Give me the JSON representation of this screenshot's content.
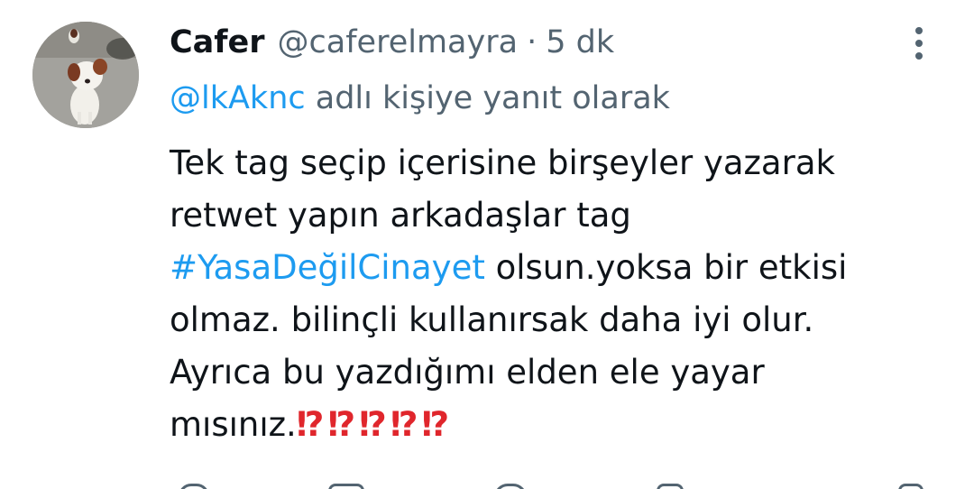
{
  "tweet": {
    "display_name": "Cafer",
    "handle": "@caferelmayra",
    "separator": "·",
    "time": "5 dk",
    "reply_mention": "@lkAknc",
    "reply_suffix": " adlı kişiye yanıt olarak",
    "body": {
      "line1": "Tek tag seçip içerisine birşeyler yazarak",
      "line2": "retwet yapın arkadaşlar tag",
      "hashtag": "#YasaDeğilCinayet",
      "line3_rest": " olsun.yoksa bir etkisi",
      "line4": "olmaz. bilinçli kullanırsak daha iyi olur.",
      "line5": "Ayrıca bu yazdığımı elden ele yayar",
      "line6": "mısınız.",
      "bangs": [
        "⁉",
        "⁉",
        "⁉",
        "⁉",
        "⁉"
      ]
    }
  },
  "icons": {
    "avatar": "dog-photo-avatar",
    "more": "more-vertical-icon",
    "actions": [
      "reply-icon",
      "retweet-icon",
      "like-icon",
      "views-icon",
      "share-icon"
    ]
  },
  "colors": {
    "link": "#1d9bf0",
    "secondary": "#536471",
    "primary_text": "#0f1419",
    "emoji_red": "#e0262c"
  }
}
